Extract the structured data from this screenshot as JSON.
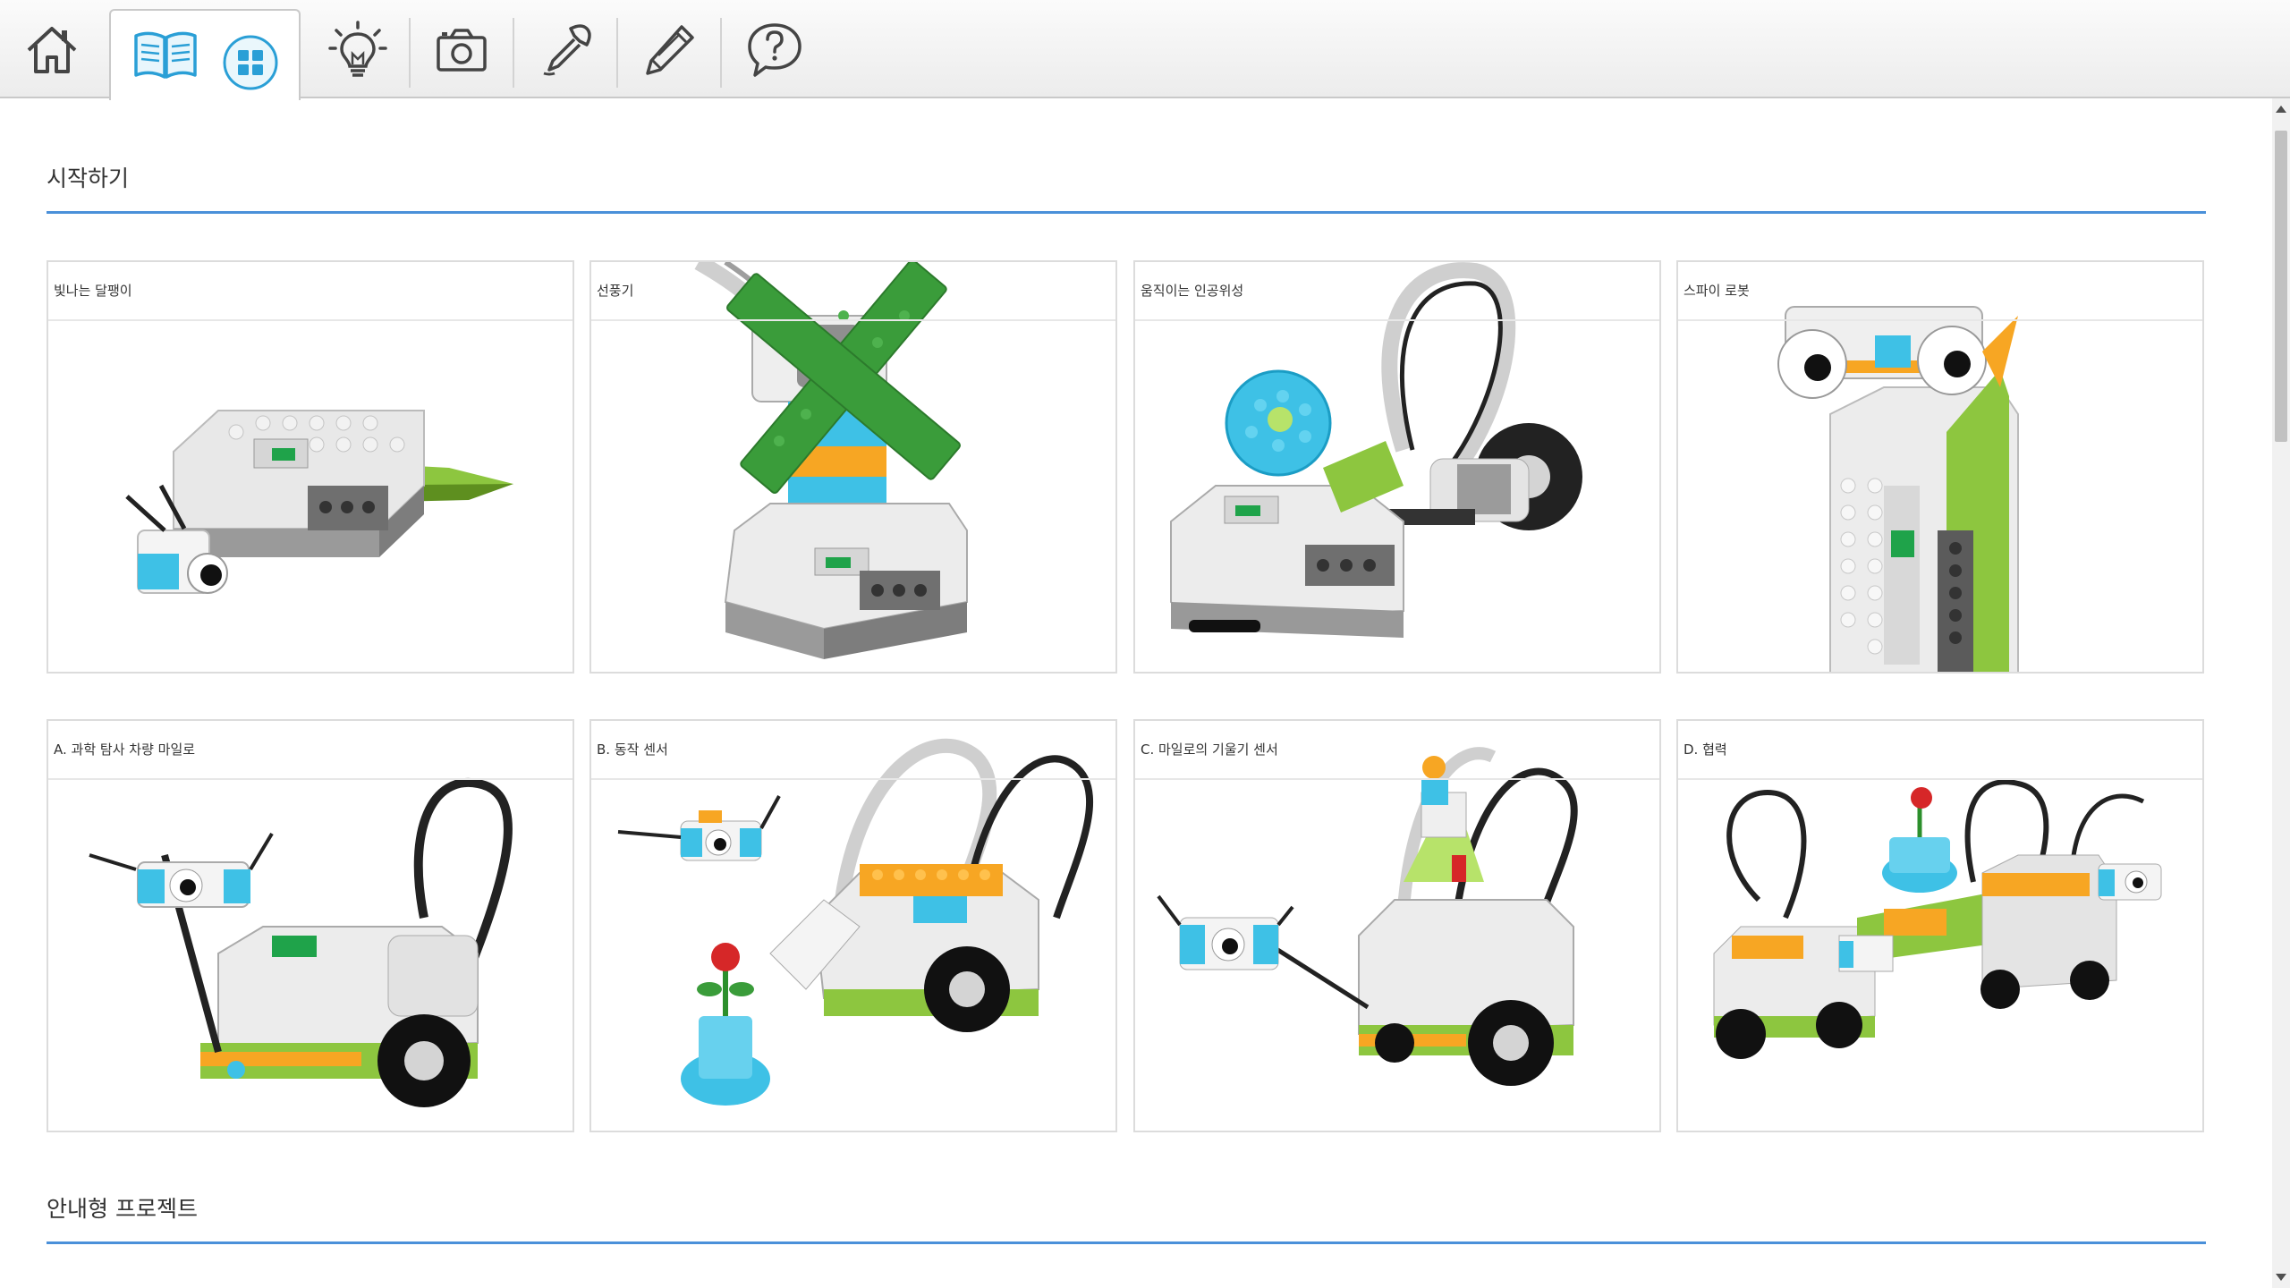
{
  "toolbar": {
    "items": [
      "home-icon",
      "book-icon",
      "grid-icon",
      "lightbulb-icon",
      "camera-icon",
      "pipette-icon",
      "pencil-icon",
      "help-bubble-icon"
    ],
    "accent_color": "#2a9fd6"
  },
  "sections": [
    {
      "title": "시작하기"
    },
    {
      "title": "안내형 프로젝트"
    }
  ],
  "cards_row1": [
    {
      "title": "빛나는 달팽이"
    },
    {
      "title": "선풍기"
    },
    {
      "title": "움직이는 인공위성"
    },
    {
      "title": "스파이 로봇"
    }
  ],
  "cards_row2": [
    {
      "title": "A. 과학 탐사 차량 마일로"
    },
    {
      "title": "B. 동작 센서"
    },
    {
      "title": "C. 마일로의 기울기 센서"
    },
    {
      "title": "D. 협력"
    }
  ],
  "colors": {
    "section_line": "#4a90d9",
    "card_border": "#dcdcdc",
    "lego_green": "#8dc63f",
    "lego_blue": "#3ec1e6",
    "lego_orange": "#f7a623"
  }
}
